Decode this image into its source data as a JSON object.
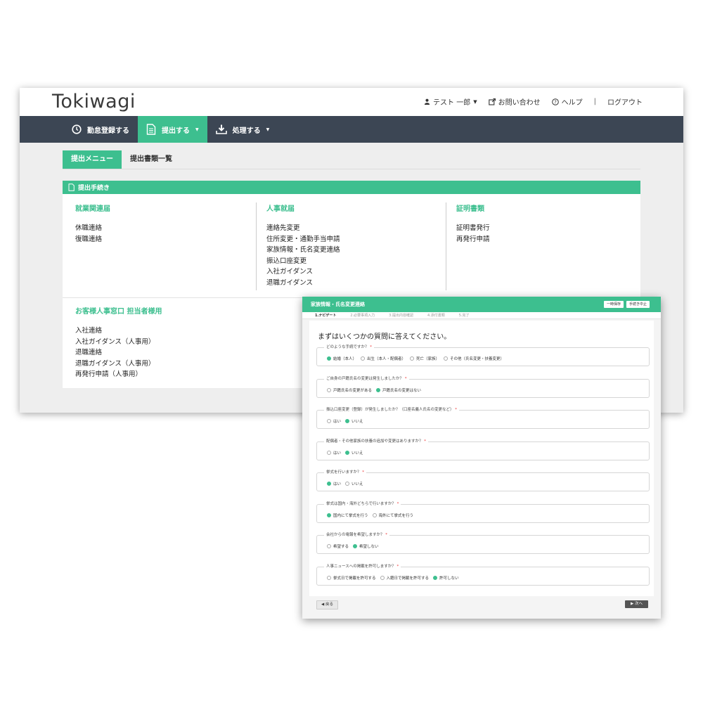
{
  "app": {
    "logo": "Tokiwagi",
    "header": {
      "user_label": "テスト 一郎",
      "contact_label": "お問い合わせ",
      "help_label": "ヘルプ",
      "separator": "|",
      "logout_label": "ログアウト"
    },
    "nav": [
      {
        "label": "勤怠登録する",
        "icon": "clock-icon"
      },
      {
        "label": "提出する",
        "icon": "document-icon"
      },
      {
        "label": "処理する",
        "icon": "download-icon"
      }
    ],
    "tabs": [
      "提出メニュー",
      "提出書類一覧"
    ],
    "panel_title": "提出手続き",
    "columns": [
      {
        "title": "就業関連届",
        "items": [
          "休職連絡",
          "復職連絡"
        ]
      },
      {
        "title": "人事就届",
        "items": [
          "連絡先変更",
          "住所変更・通勤手当申請",
          "家族情報・氏名変更連絡",
          "振込口座変更",
          "入社ガイダンス",
          "退職ガイダンス"
        ]
      },
      {
        "title": "証明書類",
        "items": [
          "証明書発行",
          "再発行申請"
        ]
      }
    ],
    "section2": {
      "title": "お客様人事窓口 担当者様用",
      "items": [
        "入社連絡",
        "入社ガイダンス（人事用）",
        "退職連絡",
        "退職ガイダンス（人事用）",
        "再発行申請（人事用）"
      ]
    },
    "colors": {
      "accent": "#3dbf8f",
      "nav_bg": "#3c4654"
    }
  },
  "dialog": {
    "title": "家族情報・氏名変更連絡",
    "buttons": [
      "一時保存",
      "手続き中止"
    ],
    "steps": [
      "1.ナビゲート",
      "2.必要事項入力",
      "3.提出内容確認",
      "4.添付書類",
      "5.完了"
    ],
    "intro": "まずはいくつかの質問に答えてください。",
    "questions": [
      {
        "label": "どのような手続ですか？",
        "options": [
          {
            "text": "結婚（本人）",
            "selected": true
          },
          {
            "text": "出生（本人・配偶者）",
            "selected": false
          },
          {
            "text": "死亡（家族）",
            "selected": false
          },
          {
            "text": "その他（氏名変更・扶養変更）",
            "selected": false
          }
        ]
      },
      {
        "label": "ご自身の戸籍氏名の変更は発生しましたか？",
        "options": [
          {
            "text": "戸籍氏名の変更がある",
            "selected": false
          },
          {
            "text": "戸籍氏名の変更はない",
            "selected": true
          }
        ]
      },
      {
        "label": "振込口座変更（登録）が発生しましたか？（口座名義人氏名の変更など）",
        "options": [
          {
            "text": "はい",
            "selected": false
          },
          {
            "text": "いいえ",
            "selected": true
          }
        ]
      },
      {
        "label": "配偶者・その他家族の扶養の追加や変更はありますか？",
        "options": [
          {
            "text": "はい",
            "selected": false
          },
          {
            "text": "いいえ",
            "selected": true
          }
        ]
      },
      {
        "label": "挙式を行いますか？",
        "options": [
          {
            "text": "はい",
            "selected": true
          },
          {
            "text": "いいえ",
            "selected": false
          }
        ]
      },
      {
        "label": "挙式は国内・海外どちらで行いますか？",
        "options": [
          {
            "text": "国内にて挙式を行う",
            "selected": true
          },
          {
            "text": "海外にて挙式を行う",
            "selected": false
          }
        ]
      },
      {
        "label": "会社からの電報を希望しますか？",
        "options": [
          {
            "text": "希望する",
            "selected": false
          },
          {
            "text": "希望しない",
            "selected": true
          }
        ]
      },
      {
        "label": "人事ニュースへの掲載を許可しますか？",
        "options": [
          {
            "text": "挙式日で掲載を許可する",
            "selected": false
          },
          {
            "text": "入籍日で掲載を許可する",
            "selected": false
          },
          {
            "text": "許可しない",
            "selected": true
          }
        ]
      }
    ],
    "back_label": "戻る",
    "next_label": "次へ"
  }
}
